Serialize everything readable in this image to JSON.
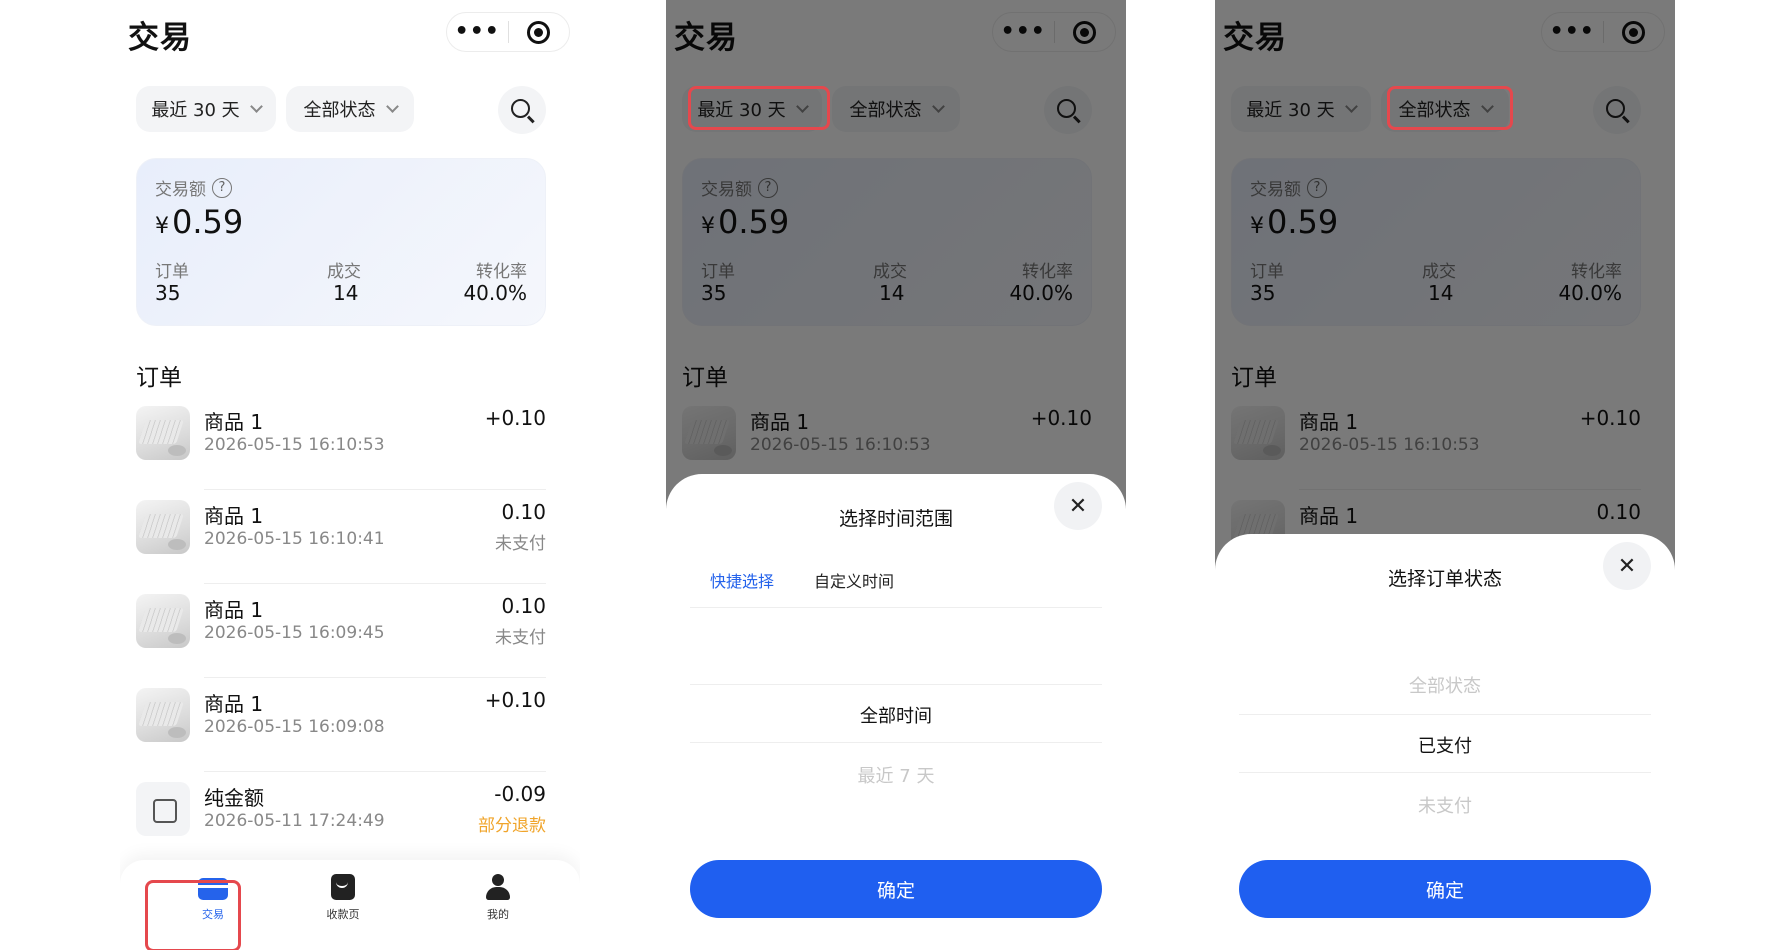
{
  "app": {
    "title": "交易",
    "more_glyph": "•••"
  },
  "filters": {
    "range_label": "最近 30 天",
    "status_label": "全部状态"
  },
  "summary": {
    "amount_label": "交易额",
    "help_glyph": "?",
    "currency": "¥",
    "amount": "0.59",
    "orders_label": "订单",
    "orders_value": "35",
    "deals_label": "成交",
    "deals_value": "14",
    "conversion_label": "转化率",
    "conversion_value": "40.0%"
  },
  "orders_section": {
    "title": "订单",
    "items": [
      {
        "name": "商品 1",
        "time": "2026-05-15 16:10:53",
        "amount": "+0.10",
        "status": ""
      },
      {
        "name": "商品 1",
        "time": "2026-05-15 16:10:41",
        "amount": "0.10",
        "status": "未支付"
      },
      {
        "name": "商品 1",
        "time": "2026-05-15 16:09:45",
        "amount": "0.10",
        "status": "未支付"
      },
      {
        "name": "商品 1",
        "time": "2026-05-15 16:09:08",
        "amount": "+0.10",
        "status": ""
      },
      {
        "name": "纯金额",
        "time": "2026-05-11 17:24:49",
        "amount": "-0.09",
        "status": "部分退款"
      }
    ]
  },
  "tabbar": {
    "items": [
      {
        "label": "交易",
        "icon": "card-icon"
      },
      {
        "label": "收款页",
        "icon": "bag-icon"
      },
      {
        "label": "我的",
        "icon": "user-icon"
      }
    ]
  },
  "time_sheet": {
    "title": "选择时间范围",
    "close_glyph": "✕",
    "tab_quick": "快捷选择",
    "tab_custom": "自定义时间",
    "options": [
      "全部时间",
      "最近 7 天"
    ],
    "confirm": "确定"
  },
  "status_sheet": {
    "title": "选择订单状态",
    "close_glyph": "✕",
    "options": [
      "全部状态",
      "已支付",
      "未支付"
    ],
    "confirm": "确定"
  },
  "colors": {
    "accent": "#1f5ff0",
    "highlight": "#e5484d",
    "refund": "#f0a42a"
  }
}
